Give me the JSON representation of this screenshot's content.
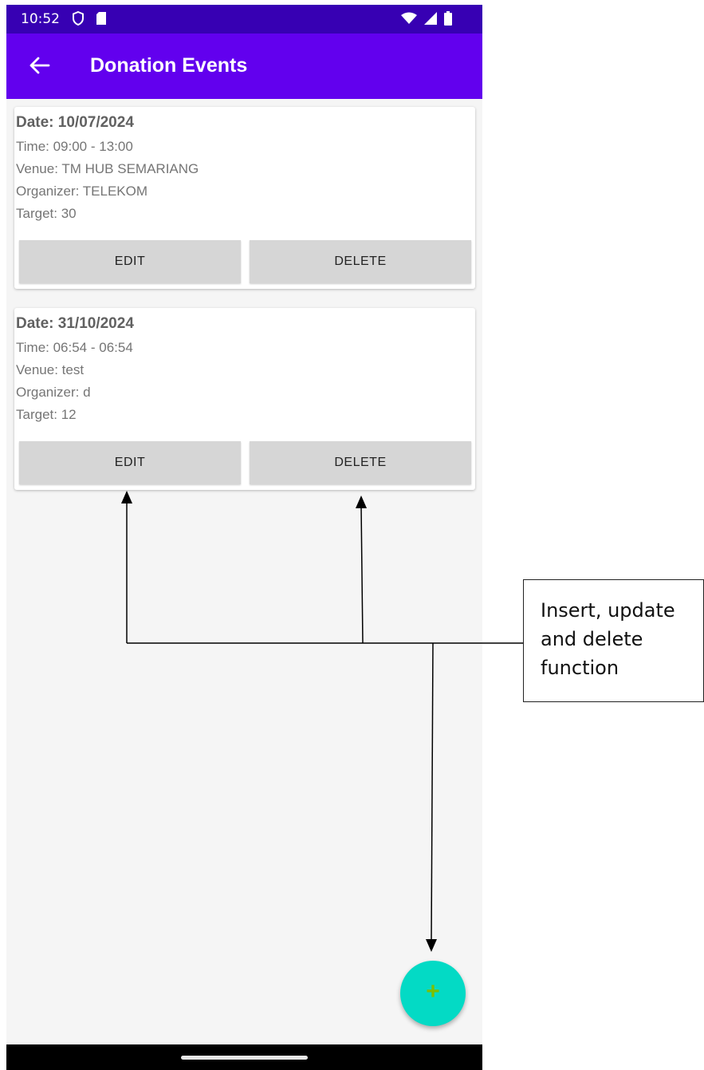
{
  "status_bar": {
    "time": "10:52"
  },
  "app_bar": {
    "title": "Donation Events"
  },
  "events": [
    {
      "date": "Date: 10/07/2024",
      "time": "Time: 09:00 - 13:00",
      "venue": "Venue: TM HUB SEMARIANG",
      "organizer": "Organizer: TELEKOM",
      "target": "Target: 30",
      "edit_label": "EDIT",
      "delete_label": "DELETE"
    },
    {
      "date": "Date: 31/10/2024",
      "time": "Time: 06:54 - 06:54",
      "venue": "Venue: test",
      "organizer": "Organizer: d",
      "target": "Target: 12",
      "edit_label": "EDIT",
      "delete_label": "DELETE"
    }
  ],
  "fab": {
    "icon": "plus-icon",
    "symbol": "+"
  },
  "annotation": {
    "text": "Insert, update and delete function"
  },
  "colors": {
    "app_bar": "#6200ee",
    "status_bar": "#3700b3",
    "fab": "#03dac5"
  }
}
